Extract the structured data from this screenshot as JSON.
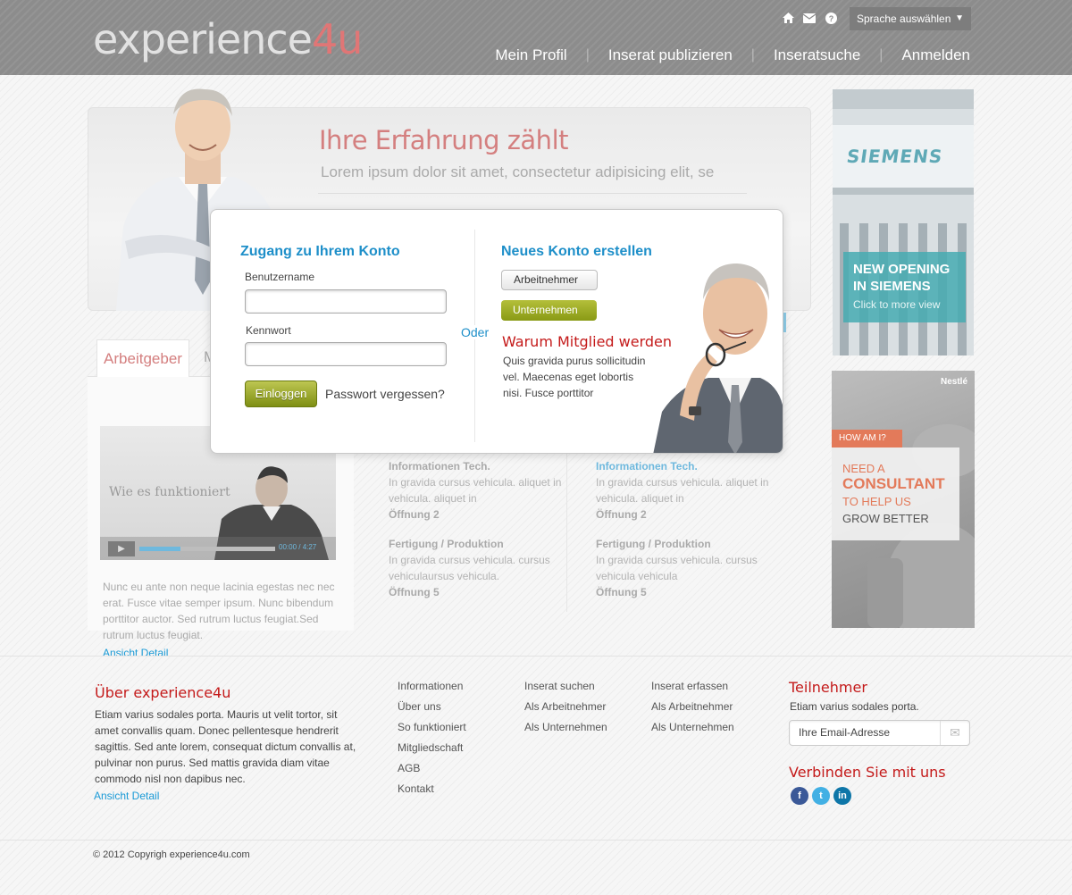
{
  "logo": {
    "main": "experience",
    "accent": "4u"
  },
  "header": {
    "language_selector": "Sprache auswählen",
    "nav": [
      "Mein Profil",
      "Inserat publizieren",
      "Inseratsuche",
      "Anmelden"
    ]
  },
  "hero": {
    "title": "Ihre Erfahrung zählt",
    "subtitle": "Lorem ipsum dolor sit amet, consectetur adipisicing elit, se"
  },
  "tabs": {
    "active_label": "Arbeitgeber",
    "second_label": "M",
    "video_title": "Wie es funktioniert",
    "video_time": "00:00 / 4:27",
    "video_progress": 0.3,
    "text": "Nunc eu ante non neque lacinia egestas nec nec erat. Fusce vitae semper ipsum. Nunc bibendum porttitor auctor. Sed rutrum luctus feugiat.Sed rutrum luctus feugiat.",
    "link": "Ansicht Detail"
  },
  "jobs": {
    "col1": [
      {
        "title": "Informationen Tech.",
        "text": "In gravida cursus vehicula. aliquet in vehicula. aliquet in",
        "open": "Öffnung 2"
      },
      {
        "title": "Fertigung / Produktion",
        "text": "In gravida cursus vehicula. cursus vehiculaursus vehicula.",
        "open": "Öffnung  5"
      }
    ],
    "col2": [
      {
        "title": "Informationen Tech.",
        "text": "In gravida cursus vehicula. aliquet in vehicula. aliquet in",
        "open": "Öffnung 2"
      },
      {
        "title": "Fertigung / Produktion",
        "text": "In gravida cursus vehicula. cursus vehicula vehicula",
        "open": "Öffnung  5"
      }
    ]
  },
  "login": {
    "title": "Zugang zu Ihrem Konto",
    "username_label": "Benutzername",
    "username_value": "",
    "password_label": "Kennwort",
    "password_value": "",
    "login_button": "Einloggen",
    "forgot": "Passwort vergessen?",
    "or": "Oder",
    "register_title": "Neues Konto erstellen",
    "btn_employee": "Arbeitnehmer",
    "btn_company": "Unternehmen",
    "why_title": "Warum Mitglied werden",
    "why_text": "Quis gravida purus sollicitudin vel. Maecenas eget lobortis nisi. Fusce porttitor"
  },
  "ads": {
    "siemens_logo": "SIEMENS",
    "siemens_headline_1": "NEW OPENING",
    "siemens_headline_2": "IN SIEMENS",
    "siemens_cta": "Click to more view",
    "nestle_brand": "Nestlé",
    "nestle_tag": "HOW AM I?",
    "nestle_l1": "NEED A",
    "nestle_l2": "CONSULTANT",
    "nestle_l3": "TO HELP US",
    "nestle_l4": "GROW BETTER"
  },
  "footer": {
    "about_title": "Über experience4u",
    "about_text": "Etiam varius sodales porta. Mauris ut velit tortor, sit amet convallis quam. Donec pellentesque hendrerit sagittis. Sed ante lorem, consequat dictum convallis at, pulvinar non purus. Sed mattis gravida diam vitae commodo nisl non dapibus nec.",
    "about_link": "Ansicht Detail",
    "col1": [
      "Informationen",
      "Über uns",
      "So funktioniert",
      "Mitgliedschaft",
      "AGB",
      "Kontakt"
    ],
    "col2": [
      "Inserat suchen",
      "Als Arbeitnehmer",
      "Als Unternehmen"
    ],
    "col3": [
      "Inserat erfassen",
      "Als Arbeitnehmer",
      "Als Unternehmen"
    ],
    "members_title": "Teilnehmer",
    "members_text": "Etiam varius sodales porta.",
    "email_placeholder": "Ihre Email-Adresse",
    "connect_title": "Verbinden Sie mit uns",
    "copyright": "© 2012 Copyrigh experience4u.com"
  },
  "colors": {
    "accent_red": "#c41a1a",
    "accent_blue": "#1e8fc9",
    "olive_button": "#899a15",
    "header_gray": "#8c8c8c"
  }
}
